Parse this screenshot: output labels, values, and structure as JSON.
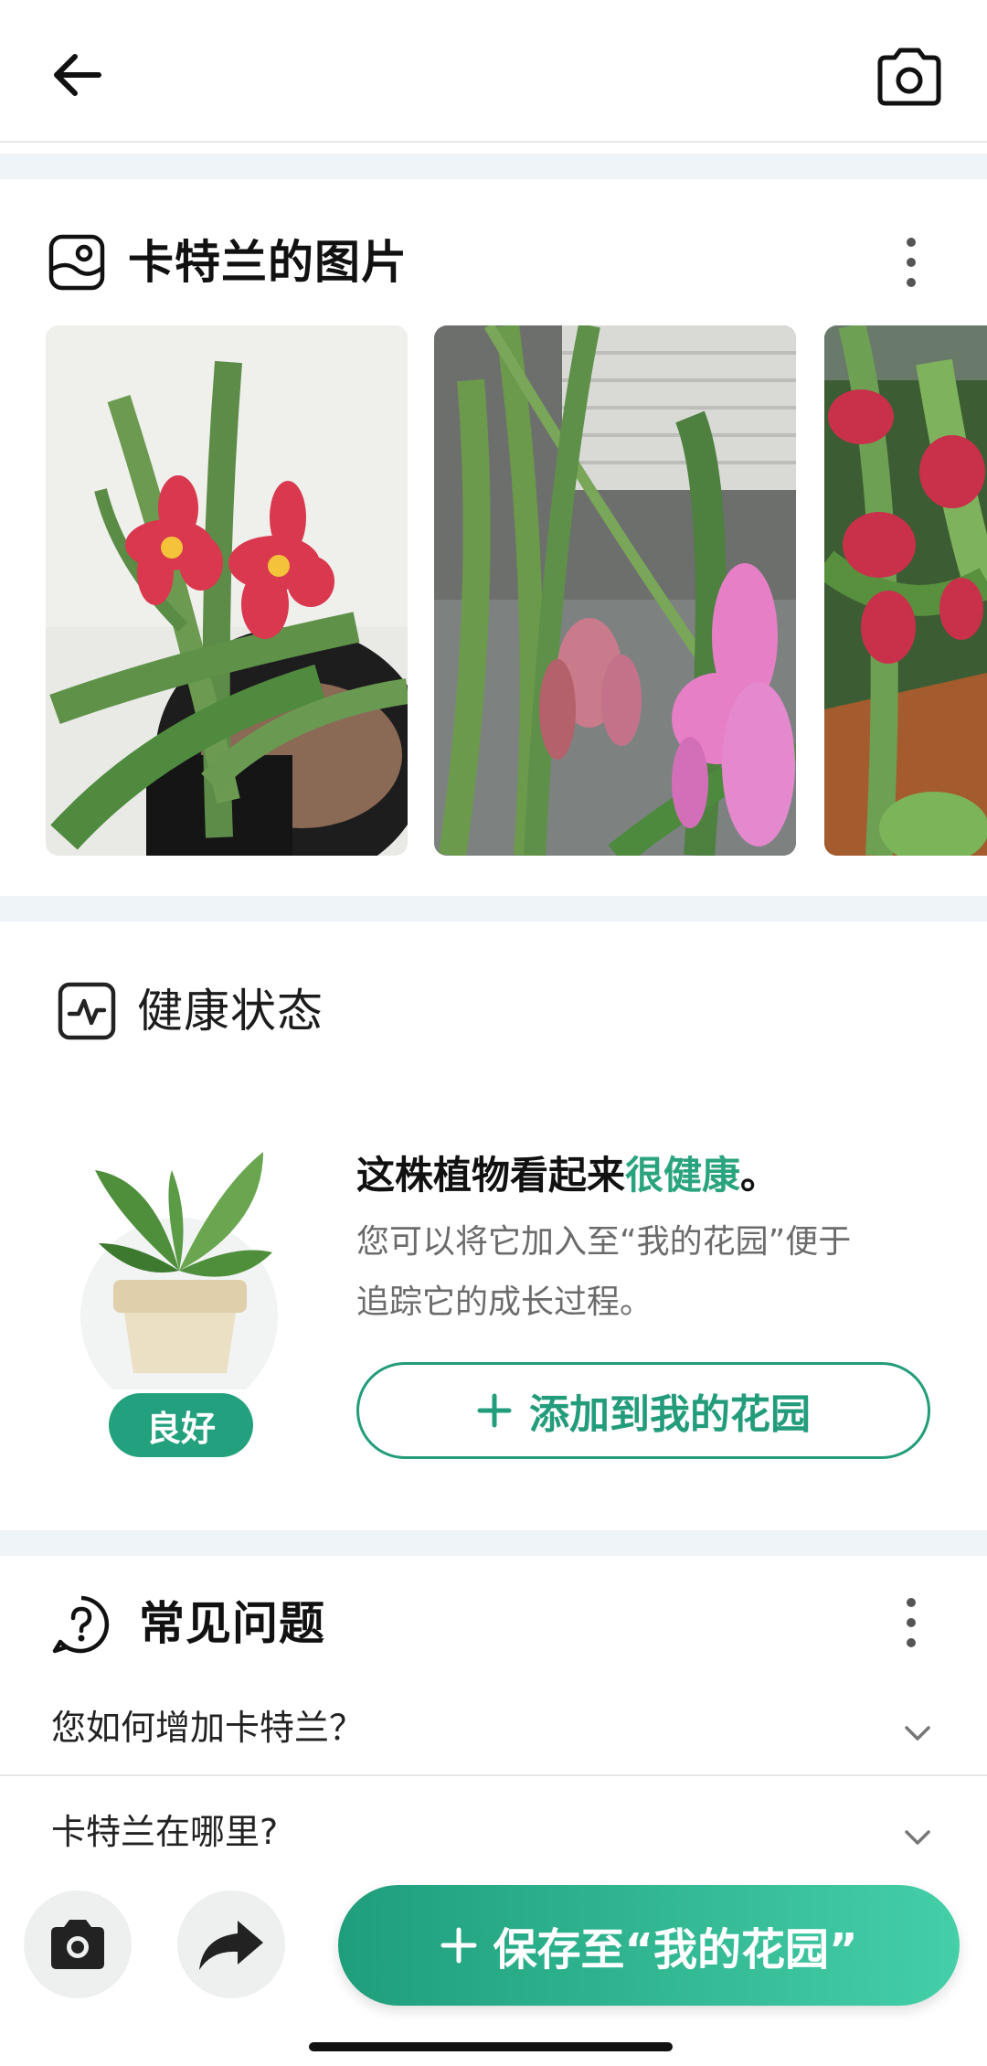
{
  "colors": {
    "accent": "#239c7c",
    "accent_light": "#44cfa8",
    "separator": "#eef4f8"
  },
  "header": {
    "back_icon": "arrow-left-icon",
    "camera_icon": "camera-icon"
  },
  "photos_section": {
    "title": "卡特兰的图片",
    "icon": "image-icon",
    "more_icon": "more-vertical-icon",
    "photos": [
      {
        "name": "photo-red-orchid"
      },
      {
        "name": "photo-pink-orchid"
      },
      {
        "name": "photo-red-orchid-cluster"
      }
    ]
  },
  "health_section": {
    "title": "健康状态",
    "icon": "pulse-icon",
    "status_badge": "良好",
    "headline_prefix": "这株植物看起来",
    "headline_highlight": "很健康",
    "headline_suffix": "。",
    "description_line1": "您可以将它加入至“我的花园”便于",
    "description_line2": "追踪它的成长过程。",
    "add_button_label": "添加到我的花园"
  },
  "faq_section": {
    "title": "常见问题",
    "icon": "help-circle-icon",
    "more_icon": "more-vertical-icon",
    "items": [
      {
        "question": "您如何增加卡特兰？"
      },
      {
        "question": "卡特兰在哪里?"
      }
    ]
  },
  "bottom_bar": {
    "camera_icon": "camera-icon",
    "share_icon": "share-icon",
    "save_label": "保存至“我的花园”"
  }
}
